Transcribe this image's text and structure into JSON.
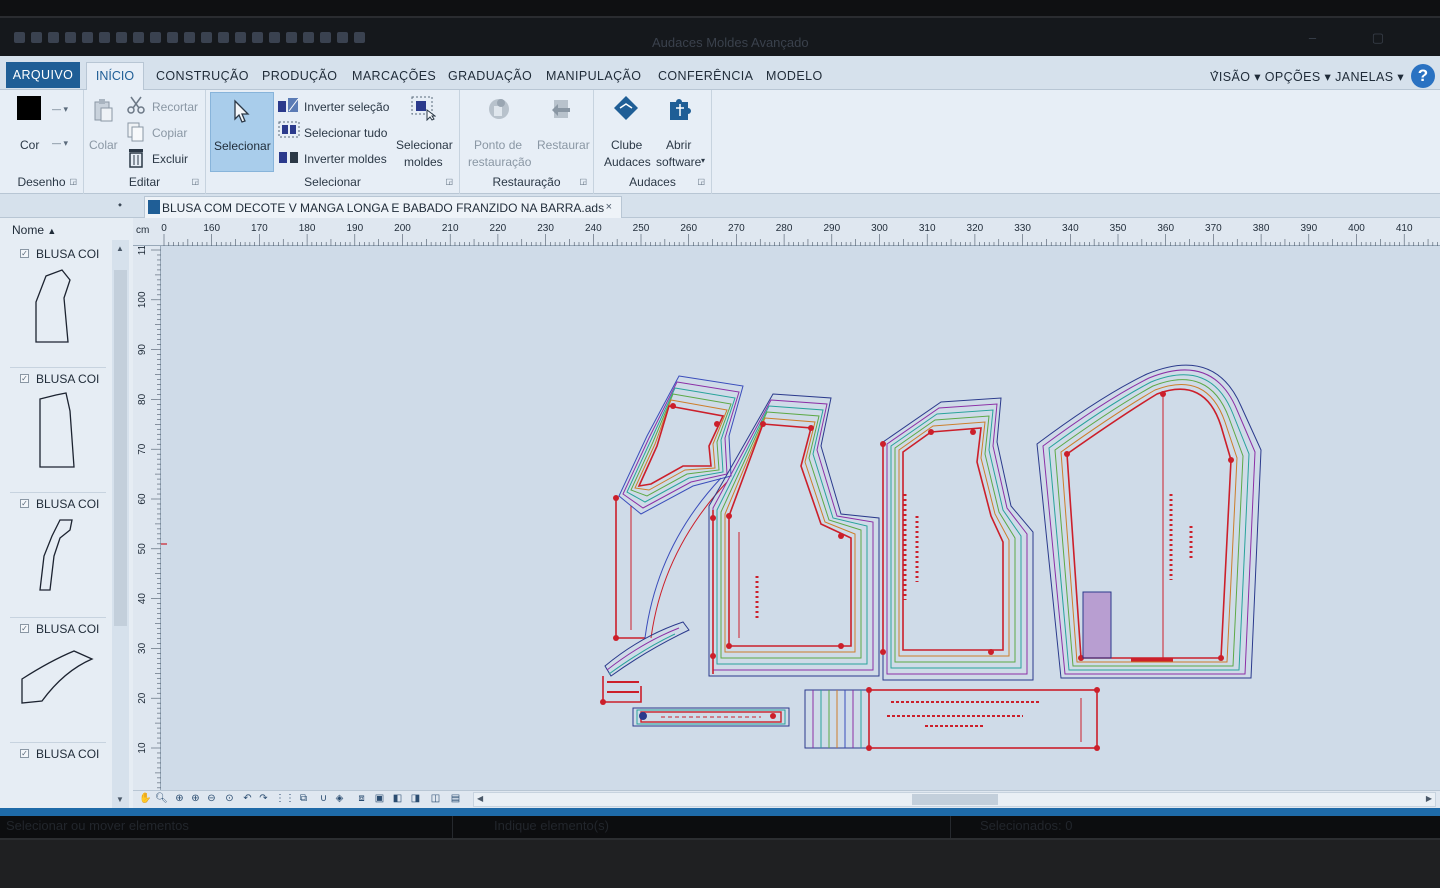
{
  "window": {
    "title": "Audaces Moldes Avançado"
  },
  "menu": {
    "file": "ARQUIVO",
    "tabs": [
      "INÍCIO",
      "CONSTRUÇÃO",
      "PRODUÇÃO",
      "MARCAÇÕES",
      "GRADUAÇÃO",
      "MANIPULAÇÃO",
      "CONFERÊNCIA",
      "MODELO"
    ],
    "right": "VISÃO ▾  OPÇÕES ▾  JANELAS ▾",
    "collapse": "⌃"
  },
  "ribbon": {
    "desenho": {
      "label": "Desenho",
      "cor": "Cor",
      "color": "#000000"
    },
    "editar": {
      "label": "Editar",
      "colar": "Colar",
      "recortar": "Recortar",
      "copiar": "Copiar",
      "excluir": "Excluir"
    },
    "selecionar": {
      "label": "Selecionar",
      "selecionar": "Selecionar",
      "inverter_selecao": "Inverter seleção",
      "selecionar_tudo": "Selecionar tudo",
      "inverter_moldes": "Inverter moldes",
      "selecionar_moldes_1": "Selecionar",
      "selecionar_moldes_2": "moldes"
    },
    "restauracao": {
      "label": "Restauração",
      "ponto_1": "Ponto de",
      "ponto_2": "restauração",
      "restaurar": "Restaurar"
    },
    "audaces": {
      "label": "Audaces",
      "clube_1": "Clube",
      "clube_2": "Audaces",
      "abrir_1": "Abrir",
      "abrir_2": "software"
    }
  },
  "document": {
    "tab_name": "BLUSA COM DECOTE V MANGA LONGA E BABADO FRANZIDO NA BARRA.ads",
    "close": "×",
    "pin": "⬩"
  },
  "panel": {
    "header": "Nome",
    "items": [
      {
        "label": "BLUSA COI"
      },
      {
        "label": "BLUSA COI"
      },
      {
        "label": "BLUSA COI"
      },
      {
        "label": "BLUSA COI"
      },
      {
        "label": "BLUSA COI"
      }
    ]
  },
  "ruler": {
    "unit": "cm",
    "h_ticks": [
      "0",
      "160",
      "170",
      "180",
      "190",
      "200",
      "210",
      "220",
      "230",
      "240",
      "250",
      "260",
      "270",
      "280",
      "290",
      "300",
      "310",
      "320",
      "330",
      "340",
      "350",
      "360",
      "370",
      "380",
      "390",
      "400",
      "410"
    ],
    "v_ticks": [
      "11",
      "100",
      "90",
      "80",
      "70",
      "60",
      "50",
      "40",
      "30",
      "20",
      "10"
    ]
  },
  "status": {
    "left": "Selecionar ou mover elementos",
    "center": "Indique elemento(s)",
    "right": "Selecionados: 0"
  },
  "colors": {
    "accent": "#1f5e96",
    "pattern_red": "#cc1f2a",
    "pattern_blue": "#2b3a8c"
  }
}
